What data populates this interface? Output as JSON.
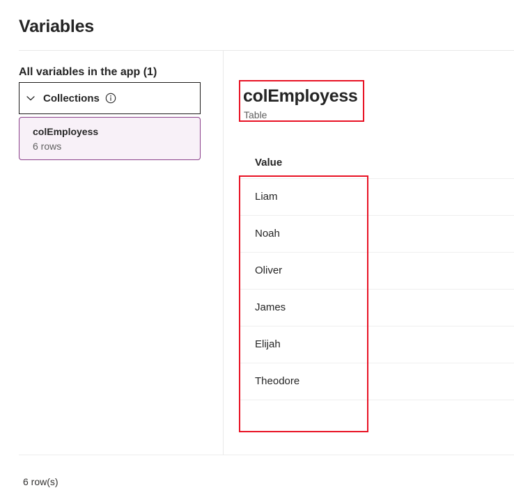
{
  "page": {
    "title": "Variables"
  },
  "sidebar": {
    "header": "All variables in the app (1)",
    "group": {
      "label": "Collections",
      "chevron_icon": "chevron-down-icon",
      "info_icon": "info-circle-icon"
    },
    "items": [
      {
        "name": "colEmployess",
        "subtitle": "6 rows",
        "selected": true
      }
    ]
  },
  "detail": {
    "variable_name": "colEmployess",
    "variable_type": "Table",
    "table": {
      "columns": [
        "Value"
      ],
      "rows": [
        {
          "value": "Liam"
        },
        {
          "value": "Noah"
        },
        {
          "value": "Oliver"
        },
        {
          "value": "James"
        },
        {
          "value": "Elijah"
        },
        {
          "value": "Theodore"
        }
      ]
    }
  },
  "footer": {
    "row_count_label": "6 row(s)"
  },
  "colors": {
    "accent_purple": "#8a3f8a",
    "selected_background": "#f8f1f8",
    "annotation_red": "#e81123",
    "divider": "#e8e8e8",
    "row_separator": "#efefef",
    "text_primary": "#242424",
    "text_secondary": "#616161"
  }
}
